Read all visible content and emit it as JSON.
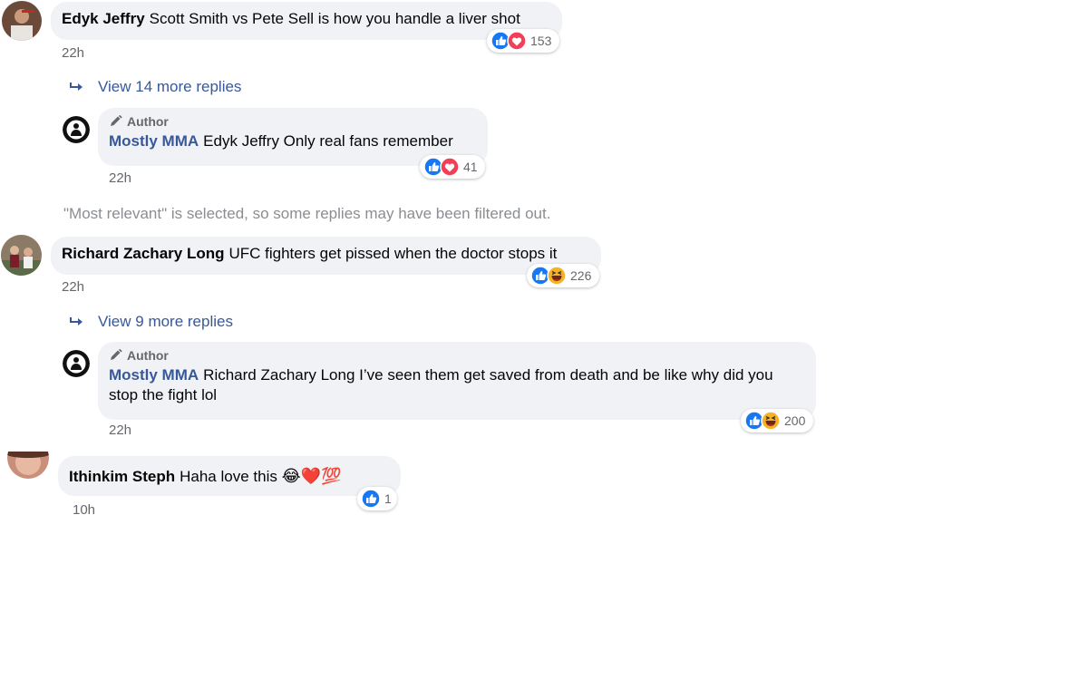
{
  "comments": [
    {
      "author": "Edyk Jeffry",
      "text": "Scott Smith vs Pete Sell is how you handle a liver shot",
      "time": "22h",
      "reactions": {
        "icons": [
          "like-icon",
          "love-icon"
        ],
        "count": "153"
      },
      "view_more": "View 14 more replies",
      "reply": {
        "badge": "Author",
        "author": "Mostly MMA",
        "text": "Edyk Jeffry Only real fans remember",
        "time": "22h",
        "reactions": {
          "icons": [
            "like-icon",
            "love-icon"
          ],
          "count": "41"
        }
      }
    },
    {
      "author": "Richard Zachary Long",
      "text": "UFC fighters get pissed when the doctor stops it",
      "time": "22h",
      "reactions": {
        "icons": [
          "like-icon",
          "haha-icon"
        ],
        "count": "226"
      },
      "view_more": "View 9 more replies",
      "reply": {
        "badge": "Author",
        "author": "Mostly MMA",
        "text": "Richard Zachary Long I’ve seen them get saved from death and be like why did you stop the fight lol",
        "time": "22h",
        "reactions": {
          "icons": [
            "like-icon",
            "haha-icon"
          ],
          "count": "200"
        }
      }
    },
    {
      "author": "Ithinkim Steph",
      "text": "Haha love this",
      "emojis": [
        "😂",
        "❤️",
        "💯"
      ],
      "time": "10h",
      "reactions": {
        "icons": [
          "like-icon"
        ],
        "count": "1"
      }
    }
  ],
  "filter_notice": "\"Most relevant\" is selected, so some replies may have been filtered out.",
  "colors": {
    "bubble": "#f0f2f5",
    "link": "#385898",
    "muted": "#65676b",
    "like_blue": "#1877f2",
    "love_red": "#f33e58",
    "haha_yellow": "#f7b125"
  }
}
